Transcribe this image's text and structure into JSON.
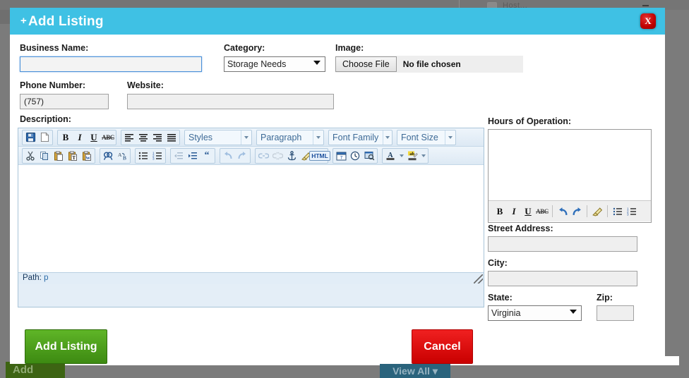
{
  "background": {
    "add_button": "Add",
    "view_all_button": "View All ▾",
    "checkbox_label": "Host..."
  },
  "modal": {
    "title": "Add Listing",
    "title_prefix": "+",
    "close_label": "X"
  },
  "form": {
    "business_name": {
      "label": "Business Name:",
      "value": "",
      "placeholder": ""
    },
    "category": {
      "label": "Category:",
      "value": "Storage Needs",
      "options": [
        "Storage Needs"
      ]
    },
    "image": {
      "label": "Image:",
      "button": "Choose File",
      "status": "No file chosen"
    },
    "phone": {
      "label": "Phone Number:",
      "value": "(757)"
    },
    "website": {
      "label": "Website:",
      "value": ""
    },
    "description": {
      "label": "Description:",
      "value": ""
    },
    "hours": {
      "label": "Hours of Operation:",
      "value": ""
    },
    "street": {
      "label": "Street Address:",
      "value": ""
    },
    "city": {
      "label": "City:",
      "value": ""
    },
    "state": {
      "label": "State:",
      "value": "Virginia",
      "options": [
        "Virginia"
      ]
    },
    "zip": {
      "label": "Zip:",
      "value": ""
    }
  },
  "editor": {
    "path_label": "Path:",
    "path_value": "p",
    "styles_select": "Styles",
    "paragraph_select": "Paragraph",
    "fontfamily_select": "Font Family",
    "fontsize_select": "Font Size",
    "html_button": "HTML",
    "toolbar_row1": [
      "save-icon",
      "new-document-icon",
      "bold-icon",
      "italic-icon",
      "underline-icon",
      "strikethrough-icon",
      "align-left-icon",
      "align-center-icon",
      "align-right-icon",
      "align-justify-icon"
    ],
    "toolbar_row2": [
      "cut-icon",
      "copy-icon",
      "paste-icon",
      "paste-text-icon",
      "paste-word-icon",
      "find-icon",
      "find-replace-icon",
      "bullet-list-icon",
      "numbered-list-icon",
      "outdent-icon",
      "indent-icon",
      "blockquote-icon",
      "undo-icon",
      "redo-icon",
      "link-icon",
      "unlink-icon",
      "anchor-icon",
      "cleanup-icon",
      "html-icon",
      "insert-date-icon",
      "insert-time-icon",
      "preview-icon",
      "text-color-icon",
      "background-color-icon"
    ],
    "hours_toolbar": [
      "bold-icon",
      "italic-icon",
      "underline-icon",
      "strikethrough-icon",
      "undo-icon",
      "redo-icon",
      "cleanup-icon",
      "bullet-list-icon",
      "numbered-list-icon"
    ]
  },
  "actions": {
    "submit": "Add Listing",
    "cancel": "Cancel"
  },
  "colors": {
    "header": "#3fc1e4",
    "submit": "#4aa318",
    "cancel": "#e00000",
    "close": "#c00000",
    "editor_chrome": "#e4eef7"
  }
}
